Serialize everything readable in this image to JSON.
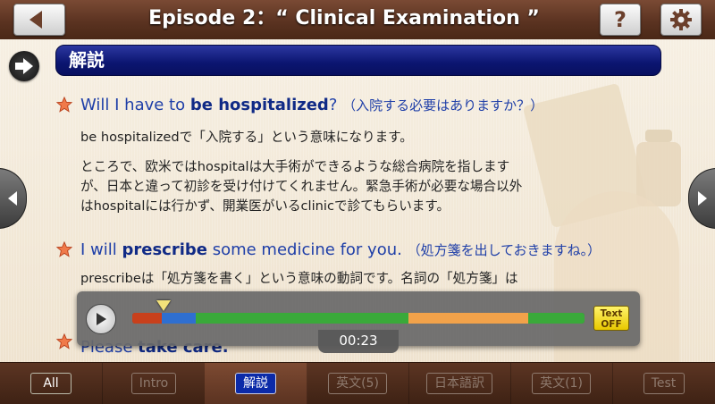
{
  "header": {
    "title": "Episode 2：“ Clinical Examination ”",
    "help_label": "?"
  },
  "section": {
    "title": "解説"
  },
  "items": [
    {
      "en_pre": "Will I have to ",
      "en_bold": "be hospitalized",
      "en_post": "?",
      "jp": "（入院する必要はありますか？）",
      "notes": [
        "be hospitalizedで「入院する」という意味になります。",
        "ところで、欧米ではhospitalは大手術ができるような総合病院を指します",
        "が、日本と違って初診を受け付けてくれません。緊急手術が必要な場合以外",
        "はhospitalには行かず、開業医がいるclinicで診てもらいます。"
      ]
    },
    {
      "en_pre": "I will ",
      "en_bold": "prescribe",
      "en_post": " some medicine for you.",
      "jp": "（処方箋を出しておきますね。）",
      "notes": [
        "prescribeは「処方箋を書く」という意味の動詞です。名詞の「処方箋」は"
      ]
    },
    {
      "en_pre": "Please ",
      "en_bold": "take care.",
      "en_post": "",
      "jp": ""
    }
  ],
  "player": {
    "time": "00:23",
    "text_toggle_line1": "Text",
    "text_toggle_line2": "OFF",
    "progress_fraction": 0.07,
    "segments": [
      {
        "color": "#c8401c",
        "fraction": 0.065
      },
      {
        "color": "#2f6fd0",
        "fraction": 0.075
      },
      {
        "color": "#3aa93a",
        "fraction": 0.47
      },
      {
        "color": "#f2a24a",
        "fraction": 0.265
      },
      {
        "color": "#3aa93a",
        "fraction": 0.125
      }
    ]
  },
  "tabs": [
    {
      "label": "All",
      "state": "normal"
    },
    {
      "label": "Intro",
      "state": "disabled"
    },
    {
      "label": "解説",
      "state": "active"
    },
    {
      "label": "英文(5)",
      "state": "disabled"
    },
    {
      "label": "日本語訳",
      "state": "disabled"
    },
    {
      "label": "英文(1)",
      "state": "disabled"
    },
    {
      "label": "Test",
      "state": "disabled"
    }
  ],
  "icons": {
    "back": "back-arrow-icon",
    "help": "question-icon",
    "settings": "gear-icon",
    "section": "right-arrow-icon",
    "star": "star-icon",
    "play": "play-icon"
  }
}
